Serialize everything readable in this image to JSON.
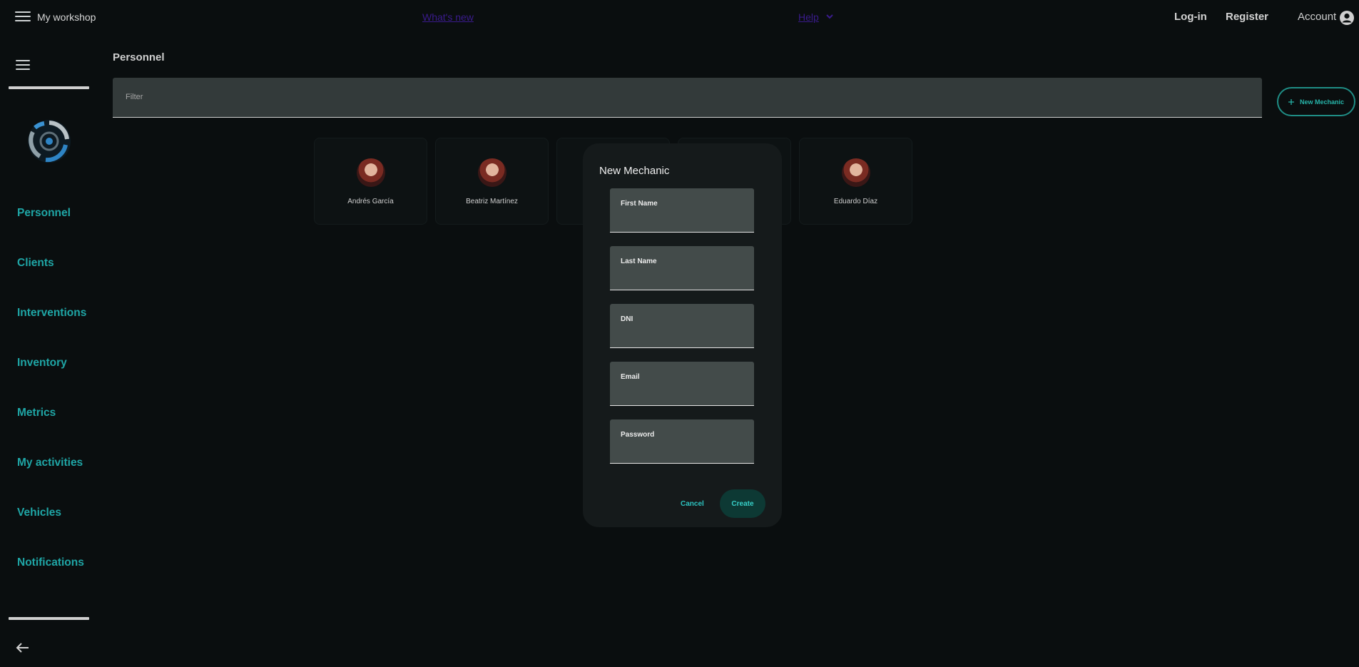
{
  "header": {
    "app_title": "My workshop",
    "whats_new": "What's new",
    "help": "Help",
    "login": "Log-in",
    "register": "Register",
    "account": "Account"
  },
  "sidebar": {
    "items": [
      {
        "label": "Personnel"
      },
      {
        "label": "Clients"
      },
      {
        "label": "Interventions"
      },
      {
        "label": "Inventory"
      },
      {
        "label": "Metrics"
      },
      {
        "label": "My activities"
      },
      {
        "label": "Vehicles"
      },
      {
        "label": "Notifications"
      }
    ]
  },
  "main": {
    "title": "Personnel",
    "filter_placeholder": "Filter",
    "new_button": "New Mechanic",
    "cards": [
      {
        "name": "Andrés García"
      },
      {
        "name": "Beatriz Martínez"
      },
      {
        "name": "Eduardo Díaz"
      }
    ]
  },
  "modal": {
    "title": "New Mechanic",
    "fields": [
      {
        "label": "First Name",
        "value": ""
      },
      {
        "label": "Last Name",
        "value": ""
      },
      {
        "label": "DNI",
        "value": ""
      },
      {
        "label": "Email",
        "value": ""
      },
      {
        "label": "Password",
        "value": ""
      }
    ],
    "cancel": "Cancel",
    "create": "Create"
  },
  "colors": {
    "accent": "#1fa6a6",
    "background": "#0a0e0f",
    "link": "#3a1b8c"
  },
  "icons": [
    "menu-icon",
    "chevron-down-icon",
    "account-circle-icon",
    "logo-icon",
    "arrow-left-icon",
    "plus-icon"
  ]
}
